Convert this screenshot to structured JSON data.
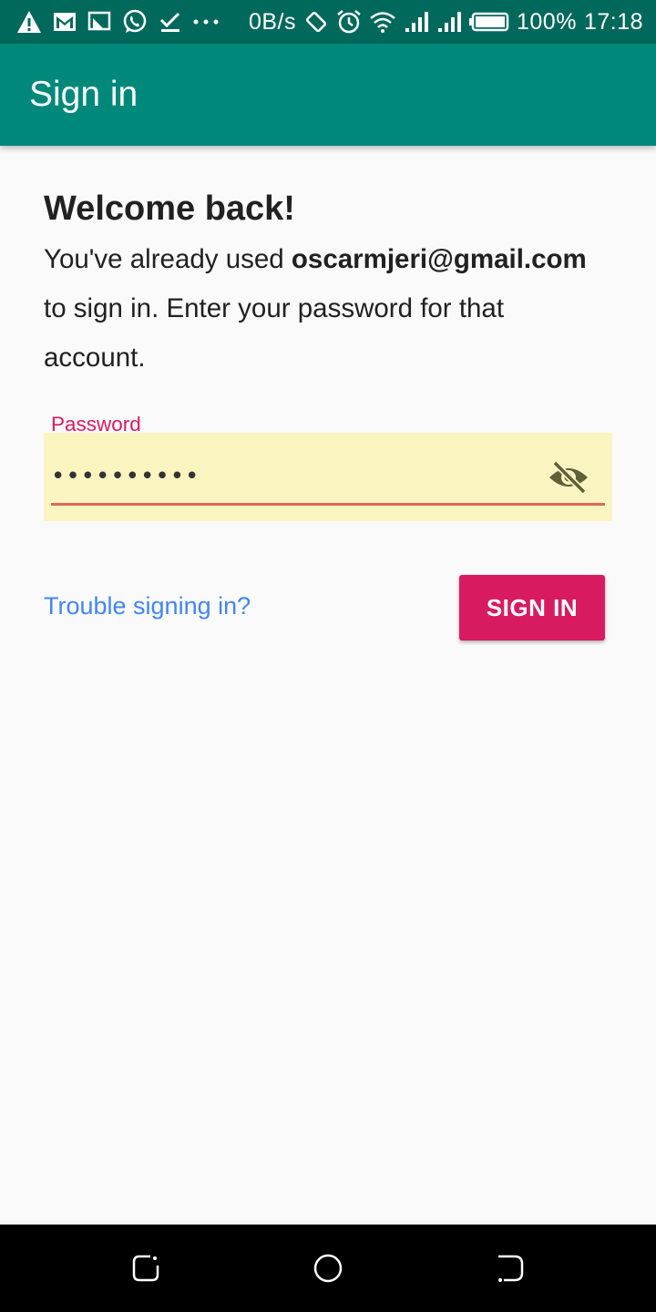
{
  "status_bar": {
    "net_speed": "0B/s",
    "battery": "100%",
    "time": "17:18",
    "icons": [
      "warning-icon",
      "gmail-icon",
      "cast-icon",
      "whatsapp-icon",
      "check-icon",
      "more-dots-icon",
      "rotate-icon",
      "alarm-icon",
      "wifi-icon",
      "signal-icon",
      "signal-icon",
      "battery-icon"
    ]
  },
  "app_bar": {
    "title": "Sign in"
  },
  "welcome": {
    "heading": "Welcome back!",
    "message_prefix": "You've already used ",
    "email": "oscarmjeri@gmail.com",
    "message_suffix": " to sign in. Enter your password for that account."
  },
  "password_field": {
    "label": "Password",
    "value": "••••••••••",
    "toggle_icon": "visibility-off-icon"
  },
  "actions": {
    "trouble_link": "Trouble signing in?",
    "sign_in_button": "SIGN IN"
  },
  "colors": {
    "status_bar": "#00695c",
    "app_bar": "#00897b",
    "accent": "#d81b60",
    "link": "#4285f4",
    "field_background": "#faf5c0"
  },
  "nav_bar": {
    "icons": [
      "recents-icon",
      "home-icon",
      "back-icon"
    ]
  }
}
